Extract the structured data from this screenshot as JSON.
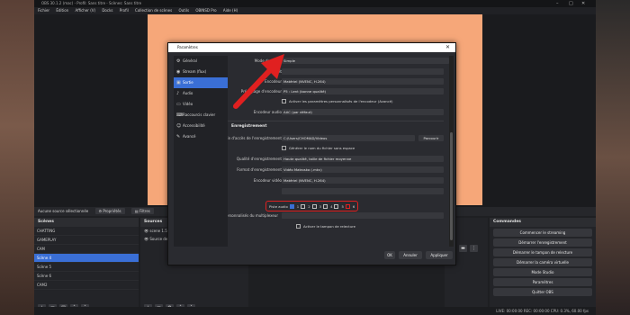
{
  "window": {
    "title": "OBS 30.1.2 (mac) - Profil: Sans titre - Scènes: Sans titre"
  },
  "menu": [
    "Fichier",
    "Édition",
    "Afficher (V)",
    "Docks",
    "Profil",
    "Collection de scènes",
    "Outils",
    "OBINSD Pro",
    "Aide (H)"
  ],
  "source_bar": {
    "no_source": "Aucune source sélectionnée",
    "properties": "Propriétés",
    "filters": "Filtres"
  },
  "scenes": {
    "title": "Scènes",
    "items": [
      "CHATTING",
      "GAMEPLAY",
      "CAM",
      "Scène 4",
      "Scène 5",
      "Scène 6",
      "CAM2"
    ],
    "active_index": 3
  },
  "sources": {
    "title": "Sources",
    "items": [
      "scene 1.5",
      "Source de couleur"
    ]
  },
  "controls": {
    "title": "Commandes",
    "buttons": [
      "Commencer le streaming",
      "Démarrer l'enregistrement",
      "Démarrer le tampon de relecture",
      "Démarrer la caméra virtuelle",
      "Mode Studio",
      "Paramètres",
      "Quitter OBS"
    ]
  },
  "statusbar": "LIVE: 00:00:00   REC: 00:00:00   CPU: 0.3%, 60.00 fps",
  "dialog": {
    "title": "Paramètres",
    "sidebar": [
      {
        "label": "Général",
        "icon": "gear-icon"
      },
      {
        "label": "Stream (flux)",
        "icon": "broadcast-icon"
      },
      {
        "label": "Sortie",
        "icon": "output-icon"
      },
      {
        "label": "Audio",
        "icon": "speaker-icon"
      },
      {
        "label": "Vidéo",
        "icon": "monitor-icon"
      },
      {
        "label": "Raccourcis clavier",
        "icon": "keyboard-icon"
      },
      {
        "label": "Accessibilité",
        "icon": "accessibility-icon"
      },
      {
        "label": "Avancé",
        "icon": "wrench-icon"
      }
    ],
    "sidebar_active_index": 2,
    "output_mode_label": "Mode de Sortie",
    "output_mode_value": "Simple",
    "streaming": {
      "bitrate_label": "Débit",
      "encoder_label": "Encodeur",
      "encoder_value": "Matériel (NVENC, H.264)",
      "preset_label": "Préréglage d'encodeur",
      "preset_value": "P5 : Lent (bonne qualité)",
      "advanced_checkbox": "Activer les paramètres personnalisés de l'encodeur (Avancé)",
      "audio_encoder_label": "Encodeur audio",
      "audio_encoder_value": "AAC (par défaut)"
    },
    "recording": {
      "section": "Enregistrement",
      "path_label": "Chemin d'accès de l'enregistrement",
      "path_value": "C:/Users/CHOMAD/Videos",
      "browse": "Parcourir",
      "nospace_checkbox": "Générer le nom du fichier sans espace",
      "quality_label": "Qualité d'enregistrement",
      "quality_value": "Haute qualité, taille de fichier moyenne",
      "format_label": "Format d'enregistrement",
      "format_value": "Vidéo Matroska (.mkv)",
      "encoder_label": "Encodeur vidéo",
      "encoder_value": "Matériel (NVENC, H.264)",
      "audio_tracks_label": "Piste audio",
      "tracks": [
        "1",
        "2",
        "3",
        "4",
        "5",
        "6"
      ],
      "custom_muxer_label": "Paramètres personnalisés du multiplexeur",
      "replay_checkbox": "Activer le tampon de relecture"
    },
    "buttons": {
      "ok": "OK",
      "cancel": "Annuler",
      "apply": "Appliquer"
    }
  },
  "annotation": {
    "arrow_color": "#e02020"
  }
}
